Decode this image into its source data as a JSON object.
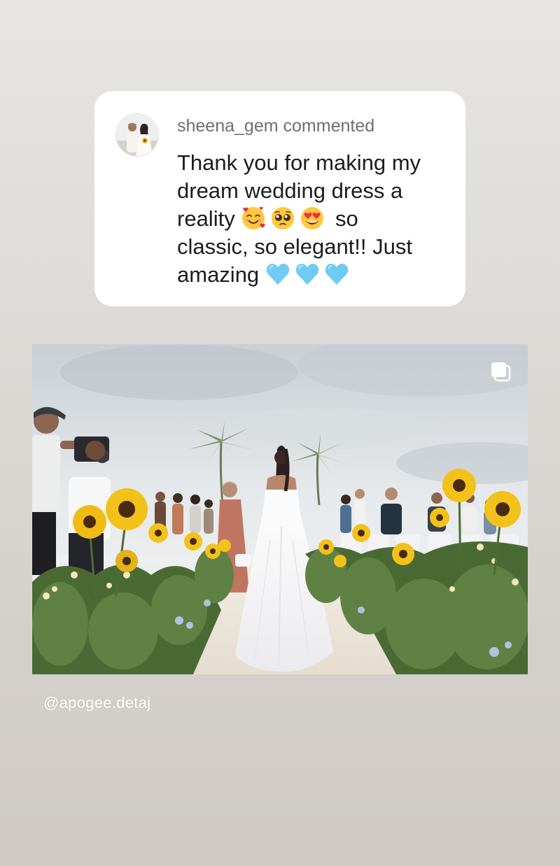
{
  "comment": {
    "username": "sheena_gem",
    "action": "commented",
    "lines": [
      "Thank you for making my",
      "dream wedding dress a",
      "reality",
      "so",
      "classic, so elegant!! Just",
      "amazing"
    ],
    "emojis": {
      "reality": [
        "smiling-face-with-hearts",
        "pleading-face",
        "heart-eyes-face"
      ],
      "amazing": [
        "light-blue-heart",
        "light-blue-heart",
        "light-blue-heart"
      ]
    }
  },
  "post": {
    "icon": "gallery-icon",
    "scene": "bride walking down sunflower-lined beach aisle"
  },
  "mention": "@apogee.detaj",
  "colors": {
    "card_background": "#ffffff",
    "username_gray": "#6f6f6f",
    "text_dark": "#1c1c1c",
    "heart_blue": "#6fcbf2",
    "sunflower": "#f2c21a"
  }
}
